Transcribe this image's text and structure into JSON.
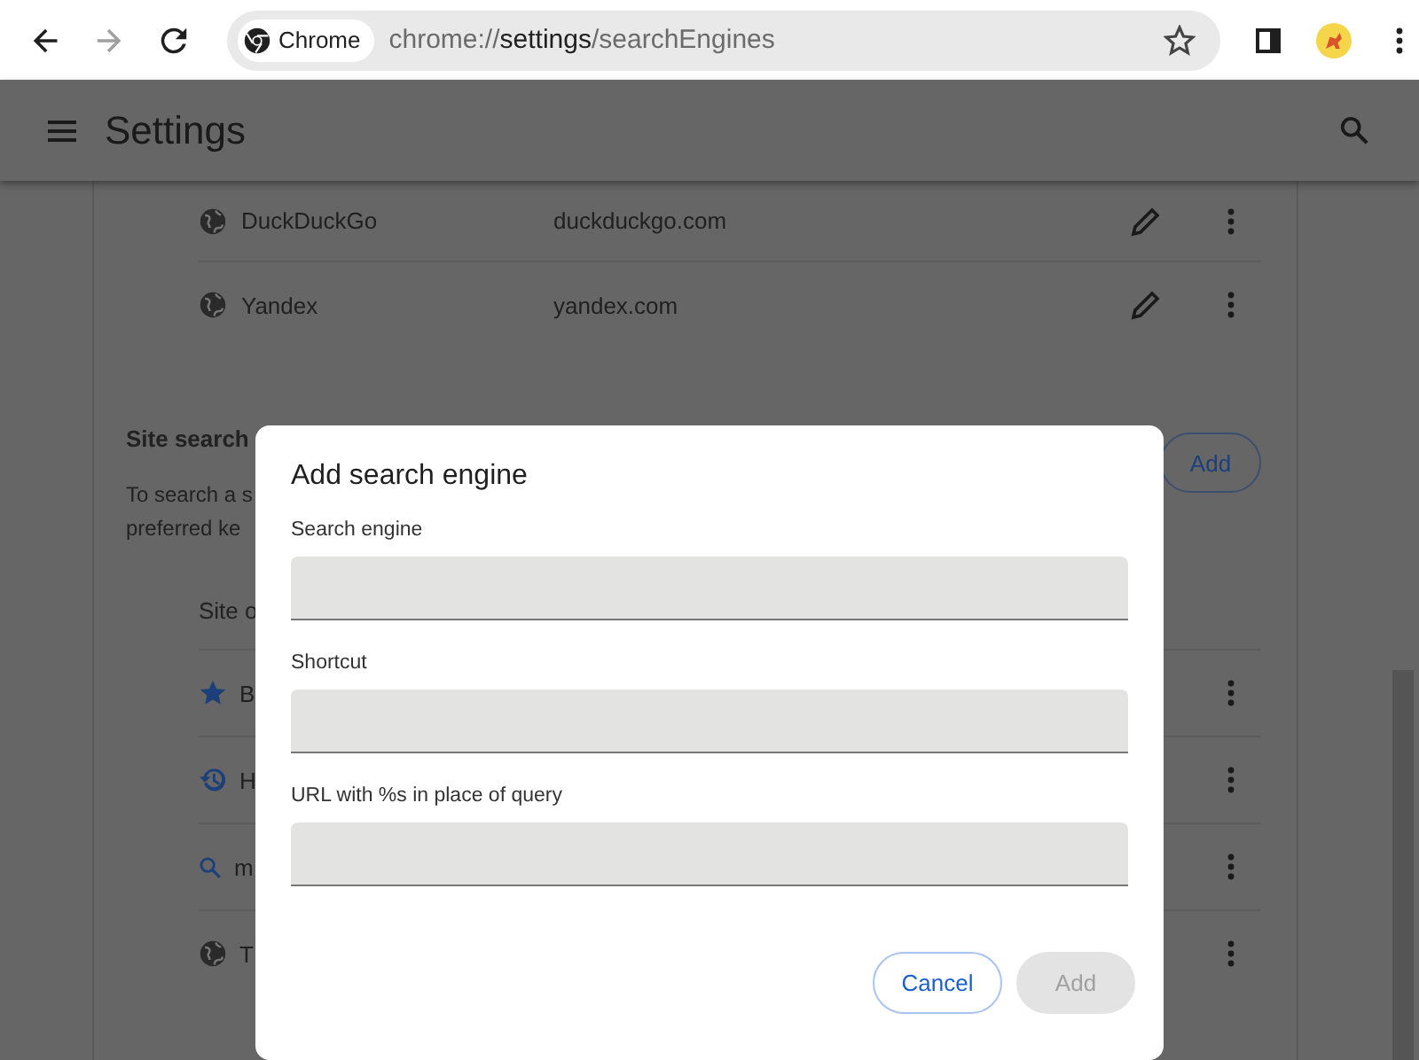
{
  "toolbar": {
    "nav_buttons": [
      {
        "kind": "back",
        "disabled": false
      },
      {
        "kind": "forward",
        "disabled": true
      },
      {
        "kind": "reload",
        "disabled": false
      }
    ],
    "omnibox": {
      "chip": "Chrome",
      "url": "chrome://**settings**/searchEngines"
    }
  },
  "header": {
    "title": "Settings"
  },
  "search_engines": [
    {
      "name": "DuckDuckGo",
      "url": "duckduckgo.com"
    },
    {
      "name": "Yandex",
      "url": "yandex.com"
    }
  ],
  "site_search": {
    "title": "Site search",
    "add_button": "Add",
    "description": [
      "To search a s",
      "preferred ke"
    ],
    "column_header": "Site o",
    "rows": [
      {
        "kind": "bookmark",
        "label": "B"
      },
      {
        "kind": "history",
        "label": "H"
      },
      {
        "kind": "search",
        "label": "m"
      },
      {
        "kind": "site",
        "label": "T"
      }
    ]
  },
  "dialog": {
    "title": "Add search engine",
    "fields": [
      {
        "label": "Search engine"
      },
      {
        "label": "Shortcut"
      },
      {
        "label": "URL with %s in place of query"
      }
    ],
    "buttons": [
      {
        "kind": "cancel",
        "label": "Cancel",
        "disabled": false
      },
      {
        "kind": "confirm",
        "label": "Add",
        "disabled": true
      }
    ]
  }
}
